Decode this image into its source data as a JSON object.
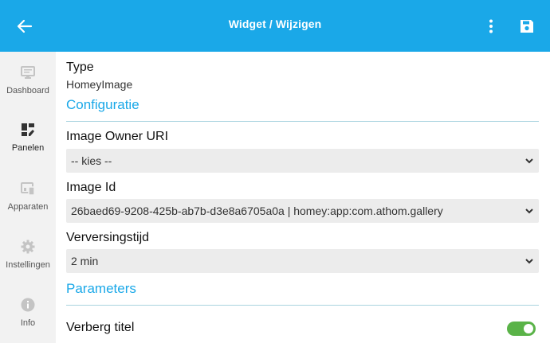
{
  "header": {
    "title": "Widget / Wijzigen",
    "accent_color": "#1aa8e8"
  },
  "sidebar": {
    "items": [
      {
        "label": "Dashboard",
        "icon": "monitor-icon",
        "active": false
      },
      {
        "label": "Panelen",
        "icon": "panels-icon",
        "active": true
      },
      {
        "label": "Apparaten",
        "icon": "devices-icon",
        "active": false
      },
      {
        "label": "Instellingen",
        "icon": "gear-icon",
        "active": false
      },
      {
        "label": "Info",
        "icon": "info-icon",
        "active": false
      }
    ]
  },
  "form": {
    "type_label": "Type",
    "type_value": "HomeyImage",
    "configuratie_heading": "Configuratie",
    "owner_label": "Image Owner URI",
    "owner_value": "-- kies --",
    "imageid_label": "Image Id",
    "imageid_value": "26baed69-9208-425b-ab7b-d3e8a6705a0a | homey:app:com.athom.gallery",
    "refresh_label": "Verversingstijd",
    "refresh_value": "2 min",
    "parameters_heading": "Parameters",
    "hide_title_label": "Verberg titel",
    "hide_title_on": true,
    "toggle_color": "#5ab348"
  }
}
